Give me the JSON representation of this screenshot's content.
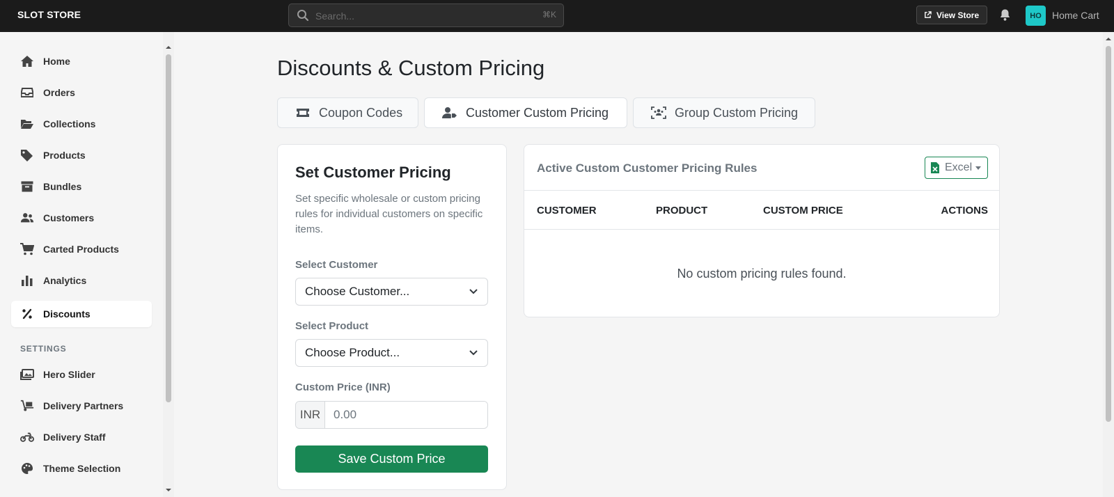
{
  "topbar": {
    "brand": "SLOT STORE",
    "search_placeholder": "Search...",
    "search_shortcut": "⌘K",
    "view_store_label": "View Store",
    "avatar_initials": "HO",
    "store_name": "Home Cart"
  },
  "sidebar": {
    "items": [
      {
        "label": "Home",
        "icon": "home-icon"
      },
      {
        "label": "Orders",
        "icon": "inbox-icon"
      },
      {
        "label": "Collections",
        "icon": "folder-open-icon"
      },
      {
        "label": "Products",
        "icon": "tags-icon"
      },
      {
        "label": "Bundles",
        "icon": "archive-box-icon"
      },
      {
        "label": "Customers",
        "icon": "users-icon"
      },
      {
        "label": "Carted Products",
        "icon": "cart-icon"
      },
      {
        "label": "Analytics",
        "icon": "bar-chart-icon"
      },
      {
        "label": "Discounts",
        "icon": "percent-icon",
        "active": true
      }
    ],
    "settings_label": "SETTINGS",
    "settings_items": [
      {
        "label": "Hero Slider",
        "icon": "images-icon"
      },
      {
        "label": "Delivery Partners",
        "icon": "dolly-icon"
      },
      {
        "label": "Delivery Staff",
        "icon": "motorcycle-icon"
      },
      {
        "label": "Theme Selection",
        "icon": "palette-icon"
      }
    ]
  },
  "main": {
    "title": "Discounts & Custom Pricing",
    "tabs": [
      {
        "label": "Coupon Codes",
        "icon": "ticket-icon"
      },
      {
        "label": "Customer Custom Pricing",
        "icon": "user-tag-icon",
        "active": true
      },
      {
        "label": "Group Custom Pricing",
        "icon": "users-viewfinder-icon"
      }
    ],
    "form": {
      "title": "Set Customer Pricing",
      "description": "Set specific wholesale or custom pricing rules for individual customers on specific items.",
      "customer_label": "Select Customer",
      "customer_value": "Choose Customer...",
      "product_label": "Select Product",
      "product_value": "Choose Product...",
      "price_label": "Custom Price (INR)",
      "price_addon": "INR",
      "price_placeholder": "0.00",
      "save_label": "Save Custom Price"
    },
    "rules": {
      "title": "Active Custom Customer Pricing Rules",
      "export_label": "Excel",
      "columns": [
        "CUSTOMER",
        "PRODUCT",
        "CUSTOM PRICE",
        "ACTIONS"
      ],
      "empty_text": "No custom pricing rules found."
    }
  },
  "colors": {
    "topbar": "#1b1b1b",
    "accent_green": "#198754",
    "avatar": "#1ec8c8",
    "background": "#f5f5f5"
  }
}
